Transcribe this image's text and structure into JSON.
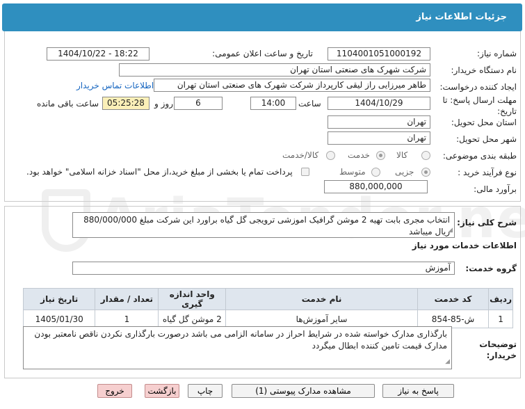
{
  "page": {
    "title": "جزئیات اطلاعات نیاز"
  },
  "watermark": {
    "text": "AriaTender.net"
  },
  "form": {
    "need_number": {
      "label": "شماره نیاز:",
      "value": "1104001051000192"
    },
    "announce_datetime": {
      "label": "تاریخ و ساعت اعلان عمومی:",
      "value": "1404/10/22 - 18:22"
    },
    "buyer_org": {
      "label": "نام دستگاه خریدار:",
      "value": "شرکت شهرک های صنعتی استان تهران"
    },
    "requester": {
      "label": "ایجاد کننده درخواست:",
      "value": "طاهر  میرزایی راز لیقی کارپرداز شرکت شهرک های صنعتی استان تهران"
    },
    "contact_link": "اطلاعات تماس خریدار",
    "deadline": {
      "label_line1": "مهلت ارسال پاسخ: تا",
      "label_line2": "تاریخ:",
      "date": "1404/10/29",
      "time_label": "ساعت",
      "time": "14:00",
      "days": "6",
      "days_label": "روز و",
      "remaining": "05:25:28",
      "remaining_label": "ساعت باقی مانده"
    },
    "province": {
      "label": "استان محل تحویل:",
      "value": "تهران"
    },
    "city": {
      "label": "شهر محل تحویل:",
      "value": "تهران"
    },
    "category": {
      "label": "طبقه بندی موضوعی:",
      "options": [
        "کالا",
        "خدمت",
        "کالا/خدمت"
      ],
      "selected": "خدمت"
    },
    "process_type": {
      "label": "نوع فرآیند خرید :",
      "options": [
        "جزیی",
        "متوسط"
      ],
      "selected": "جزیی",
      "payment_note": "پرداخت تمام یا بخشی از مبلغ خرید،از محل \"اسناد خزانه اسلامی\" خواهد بود."
    },
    "estimate": {
      "label": "برآورد مالی:",
      "value": "880,000,000"
    }
  },
  "need_description": {
    "label": "شرح کلی نیاز:",
    "text": "انتخاب مجری بابت تهیه 2 موشن گرافیک  اموزشی ترویجی گل گیاه براورد این شرکت مبلغ 880/000/000 ریال میباشد"
  },
  "services": {
    "section_title": "اطلاعات خدمات مورد نیاز",
    "group_label": "گروه خدمت:",
    "group_value": "آموزش",
    "table": {
      "headers": [
        "ردیف",
        "کد خدمت",
        "نام خدمت",
        "واحد اندازه گیری",
        "تعداد / مقدار",
        "تاریخ نیاز"
      ],
      "rows": [
        [
          "1",
          "ش-85-854",
          "سایر آموزش‌ها",
          "2 موشن گل گیاه",
          "1",
          "1405/01/30"
        ]
      ]
    }
  },
  "buyer_notes": {
    "label_line1": "توضیحات",
    "label_line2": "خریدار:",
    "text": "بارگذاری مدارک خواسته شده در شرایط احراز در سامانه الزامی می باشد درصورت بارگذاری نکردن ناقص نامعتبر بودن مدارک قیمت تامین کننده ابطال میگردد"
  },
  "buttons": {
    "reply": "پاسخ به نیاز",
    "attachments": "مشاهده مدارک پیوستی (1)",
    "print": "چاپ",
    "back": "بازگشت",
    "exit": "خروج"
  },
  "colors": {
    "header": "#2f8fbf",
    "remaining_bg": "#fbf0b8",
    "exit_bg": "#f6cfcf",
    "link": "#1565c0"
  }
}
